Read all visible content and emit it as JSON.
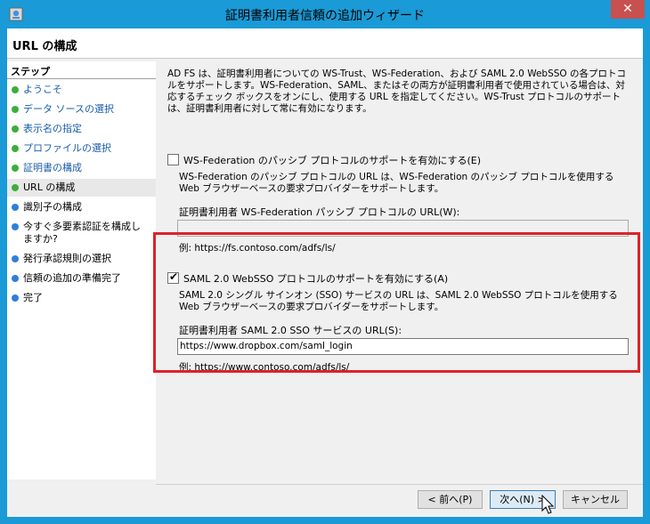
{
  "window": {
    "title": "証明書利用者信頼の追加ウィザード",
    "close_glyph": "✕"
  },
  "page": {
    "title": "URL の構成"
  },
  "steps": {
    "heading": "ステップ",
    "items": [
      {
        "label": "ようこそ",
        "status": "done"
      },
      {
        "label": "データ ソースの選択",
        "status": "done"
      },
      {
        "label": "表示名の指定",
        "status": "done"
      },
      {
        "label": "プロファイルの選択",
        "status": "done"
      },
      {
        "label": "証明書の構成",
        "status": "done"
      },
      {
        "label": "URL の構成",
        "status": "current"
      },
      {
        "label": "識別子の構成",
        "status": "todo"
      },
      {
        "label": "今すぐ多要素認証を構成しますか?",
        "status": "todo"
      },
      {
        "label": "発行承認規則の選択",
        "status": "todo"
      },
      {
        "label": "信頼の追加の準備完了",
        "status": "todo"
      },
      {
        "label": "完了",
        "status": "todo"
      }
    ]
  },
  "content": {
    "description": "AD FS は、証明書利用者についての WS-Trust、WS-Federation、および SAML 2.0 WebSSO の各プロトコルをサポートします。WS-Federation、SAML、またはその両方が証明書利用者で使用されている場合は、対応するチェック ボックスをオンにし、使用する URL を指定してください。WS-Trust プロトコルのサポートは、証明書利用者に対して常に有効になります。",
    "wsfed": {
      "checkbox_label": "WS-Federation のパッシブ プロトコルのサポートを有効にする(E)",
      "checked": false,
      "help": "WS-Federation のパッシブ プロトコルの URL は、WS-Federation のパッシブ プロトコルを使用する Web ブラウザーベースの要求プロバイダーをサポートします。",
      "field_label": "証明書利用者 WS-Federation パッシブ プロトコルの URL(W):",
      "value": "",
      "example": "例: https://fs.contoso.com/adfs/ls/"
    },
    "saml": {
      "checkbox_label": "SAML 2.0 WebSSO プロトコルのサポートを有効にする(A)",
      "checked": true,
      "check_glyph": "✔",
      "help": "SAML 2.0 シングル サインオン (SSO) サービスの URL は、SAML 2.0 WebSSO プロトコルを使用する Web ブラウザーベースの要求プロバイダーをサポートします。",
      "field_label": "証明書利用者 SAML 2.0 SSO サービスの URL(S):",
      "value": "https://www.dropbox.com/saml_login",
      "example": "例: https://www.contoso.com/adfs/ls/"
    }
  },
  "buttons": {
    "back": "< 前へ(P)",
    "next": "次へ(N) >",
    "cancel": "キャンセル"
  },
  "colors": {
    "titlebar": "#1a9ad6",
    "highlight": "#e0202a",
    "close": "#c75050"
  }
}
